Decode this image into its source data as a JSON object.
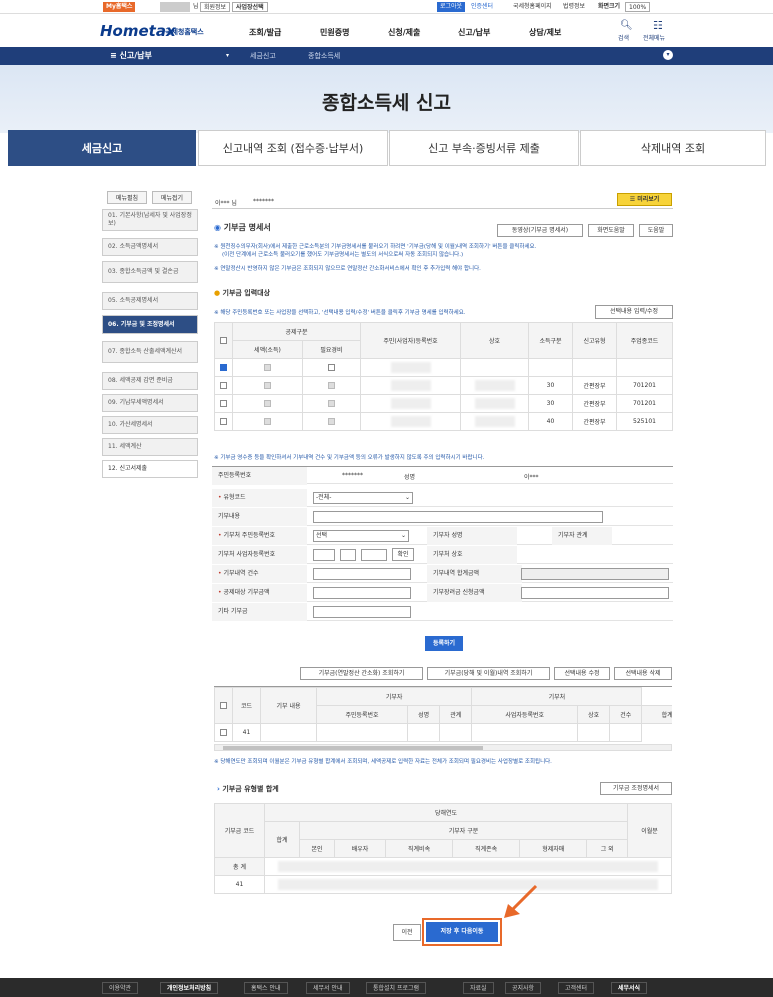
{
  "topbar": {
    "my_hometax": "My홈택스",
    "user_suffix": "님",
    "member_info": "회원정보",
    "business_select": "사업장선택",
    "logout": "로그아웃",
    "cert_center": "인증센터",
    "home_go": "국세청홈페이지",
    "corp_info": "법령정보",
    "screen_size": "화면크기",
    "zoom": "100%"
  },
  "logo": {
    "main": "Hometax",
    "sub": "국세청홈택스"
  },
  "menu": [
    "조회/발급",
    "민원증명",
    "신청/제출",
    "신고/납부",
    "상담/제보"
  ],
  "nav_right": {
    "search": "검색",
    "all_menu": "전체메뉴"
  },
  "breadcrumb": {
    "section": "신고/납부",
    "level2": "세금신고",
    "level3": "종합소득세"
  },
  "hero_title": "종합소득세 신고",
  "tabs": [
    "세금신고",
    "신고내역 조회 (접수증·납부서)",
    "신고 부속·증빙서류 제출",
    "삭제내역 조회"
  ],
  "side": {
    "expand": "메뉴펼침",
    "collapse": "메뉴접기",
    "steps": [
      "01. 기본사항(납세자 및 사업장정보)",
      "02. 소득금액명세서",
      "03. 종합소득금액 및 결손금",
      "05. 소득공제명세서",
      "06. 기부금 및 조정명세서",
      "07. 종합소득 산출세액계산서",
      "08. 세액공제 감면 준비금",
      "09. 기납부세액명세서",
      "10. 가산세명세서",
      "11. 세액계산",
      "12. 신고서제출"
    ]
  },
  "main": {
    "user": "이*** 님",
    "user_id": "*******",
    "preview": "미리보기",
    "section_title": "기부금 명세서",
    "btn_video": "동영상(기부금 명세서)",
    "btn_screen_help": "화면도움말",
    "btn_help": "도움말",
    "note1": "※ 원천징수의무자(회사)에서 제출한 근로소득분의 기부금명세서를 불러오기 하려면 '기부금(당해 및 이월)내역 조회하기' 버튼을 클릭하세요.",
    "note1b": "(이전 단계에서 근로소득 불러오기를 했어도 기부금명세서는 별도의 서식으로써 자동 조회되지 않습니다.)",
    "note2": "※ 연말정산시 반영하지 않은 기부금은 조회되지 않으므로 연말정산 간소화서비스에서 확인 후 추가입력 해야 합니다.",
    "subsection": "기부금 입력대상",
    "note3": "※ 해당 주민등록번호 또는 사업장을 선택하고, '선택내용 입력/수정' 버튼을 클릭후 기부금 명세를 입력하세요.",
    "btn_select_edit": "선택내용 입력/수정",
    "t1_headers": {
      "gongje": "공제구분",
      "seaek": "세액(소득)",
      "pilyo": "필요경비",
      "jumin": "주민(사업자)등록번호",
      "sangho": "상호",
      "sodeuk": "소득구분",
      "singo": "신고유형",
      "jueop": "주업종코드"
    },
    "t1_rows": [
      {
        "sodeuk": "",
        "singo": "",
        "jueop": ""
      },
      {
        "sodeuk": "30",
        "singo": "간편장부",
        "jueop": "701201"
      },
      {
        "sodeuk": "30",
        "singo": "간편장부",
        "jueop": "701201"
      },
      {
        "sodeuk": "40",
        "singo": "간편장부",
        "jueop": "525101"
      }
    ],
    "note4": "※ 기부금 영수증 등을 확인하셔서 기부내역 건수 및 기부금액 등의 오류가 발생하지 않도록 주의 입력하시기 바랍니다.",
    "form": {
      "jumin_label": "주민등록번호",
      "jumin_val": "*******",
      "name_label": "성명",
      "name_val": "이***",
      "type_label": "유형코드",
      "type_val": "-전체-",
      "content_label": "기부내용",
      "donor_jumin_label": "기부처 주민등록번호",
      "donor_jumin_val": "선택",
      "donor_name_label": "기부자 성명",
      "donor_rel_label": "기부자 관계",
      "biz_label": "기부처 사업자등록번호",
      "confirm": "확인",
      "biz_name_label": "기부처 상호",
      "count_label": "기부내역 건수",
      "total_label": "기부내역 합계금액",
      "deduct_label": "공제대상 기부금액",
      "encourage_label": "기부장려금 신청금액",
      "etc_label": "기타 기부금"
    },
    "btn_register": "등록하기",
    "btn_row2": [
      "기부금(연말정산 간소화) 조회하기",
      "기부금(당해 및 이월)내역 조회하기",
      "선택내용 수정",
      "선택내용 삭제"
    ],
    "t2_headers": {
      "code": "코드",
      "content": "기부 내용",
      "donor": "기부자",
      "jumin": "주민등록번호",
      "name": "성명",
      "rel": "관계",
      "place": "기부처",
      "biz": "사업자등록번호",
      "sangho": "상호",
      "count": "건수",
      "amount": "합계금액"
    },
    "t2_row": {
      "code": "41"
    },
    "note5": "※ 당해연도만 조회되며 이월분은 기부금 유형별 합계에서 조회되며, 세액공제로 입력한 자료는 전체가 조회되며 필요경비는 사업장별로 조회됩니다.",
    "type_total_title": "기부금 유형별 합계",
    "btn_adjust": "기부금 조정명세서",
    "t3_headers": {
      "code": "기부금 코드",
      "year": "당해연도",
      "gubun": "기부자 구분",
      "total": "합계",
      "self": "본인",
      "spouse": "배우자",
      "desc": "직계비속",
      "asc": "직계존속",
      "sibling": "형제자매",
      "other": "그 외",
      "carry": "이월분"
    },
    "t3_rows": [
      "총 계",
      "41"
    ],
    "btn_prev": "이전",
    "btn_next": "저장 후 다음이동"
  },
  "footer": [
    "이용약관",
    "개인정보처리방침",
    "홈택스 안내",
    "세무서 안내",
    "통합설치 프로그램",
    "자료실",
    "공지사항",
    "고객센터",
    "세무서식"
  ],
  "colors": {
    "primary": "#2d4e85",
    "accent": "#e8692a",
    "red": "#c0392b"
  }
}
